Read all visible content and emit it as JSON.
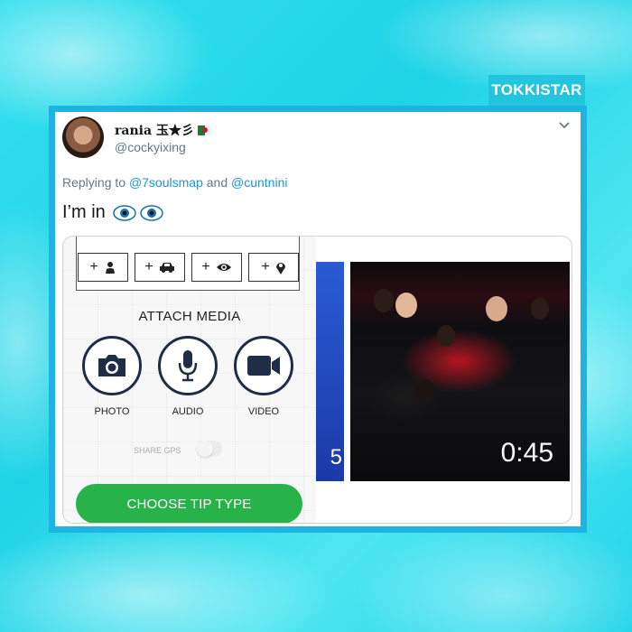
{
  "brand": "TOKKISTAR",
  "tweet": {
    "name": "rania 玉★彡",
    "handle": "@cockyixing",
    "reply_prefix": "Replying to",
    "reply_user1": "@7soulsmap",
    "reply_and": "and",
    "reply_user2": "@cuntnini",
    "text": "I’m in"
  },
  "app": {
    "toolbar": [
      {
        "plus": "+",
        "icon": "person-icon"
      },
      {
        "plus": "+",
        "icon": "car-icon"
      },
      {
        "plus": "+",
        "icon": "eye-icon"
      },
      {
        "plus": "+",
        "icon": "location-pin-icon"
      }
    ],
    "attach_label": "ATTACH MEDIA",
    "photo_label": "PHOTO",
    "audio_label": "AUDIO",
    "video_label": "VIDEO",
    "share_label": "SHARE GPS",
    "choose_label": "CHOOSE TIP TYPE"
  },
  "video": {
    "strip_digit": "5",
    "duration": "0:45"
  },
  "colors": {
    "accent_blue": "#1b95e0",
    "frame": "#1eb3e0",
    "brand_bg": "#23c4dd",
    "green": "#27b34a",
    "navy": "#1f2d46"
  }
}
